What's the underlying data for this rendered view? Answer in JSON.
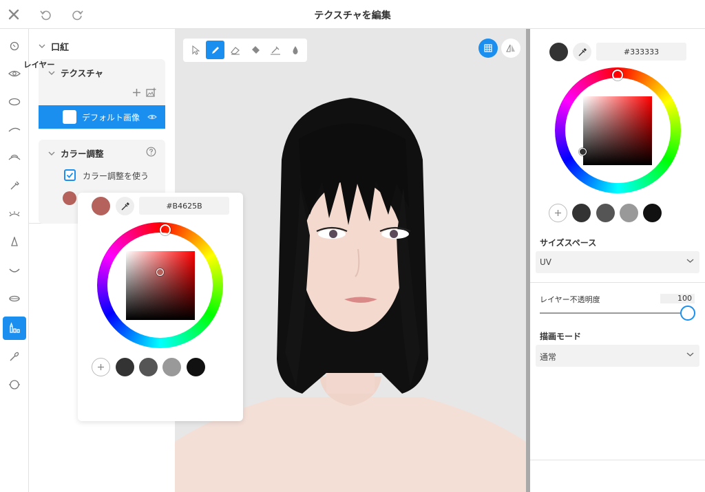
{
  "header": {
    "title": "テクスチャを編集"
  },
  "left_panel": {
    "section_title": "口紅",
    "texture": {
      "title": "テクスチャ",
      "layer_label": "レイヤー",
      "layer_name": "デフォルト画像"
    },
    "color_adjust": {
      "title": "カラー調整",
      "checkbox_label": "カラー調整を使う",
      "checked": true,
      "swatch_color": "#B4625B"
    }
  },
  "color_popup": {
    "hex": "#B4625B",
    "hue_color": "#ff0000",
    "presets": [
      "#333333",
      "#555555",
      "#999999",
      "#111111"
    ]
  },
  "right_panel": {
    "hex": "#333333",
    "hue_color": "#ff0000",
    "presets": [
      "#333333",
      "#555555",
      "#999999",
      "#111111"
    ],
    "size_space": {
      "label": "サイズスペース",
      "value": "UV"
    },
    "opacity": {
      "label": "レイヤー不透明度",
      "value": "100"
    },
    "blend_mode": {
      "label": "描画モード",
      "value": "通常"
    }
  },
  "tools": [
    "select-tool",
    "brush-tool",
    "eraser-tool",
    "fill-tool",
    "smudge-tool",
    "blur-tool"
  ],
  "colors": {
    "accent": "#1a8ff0"
  }
}
